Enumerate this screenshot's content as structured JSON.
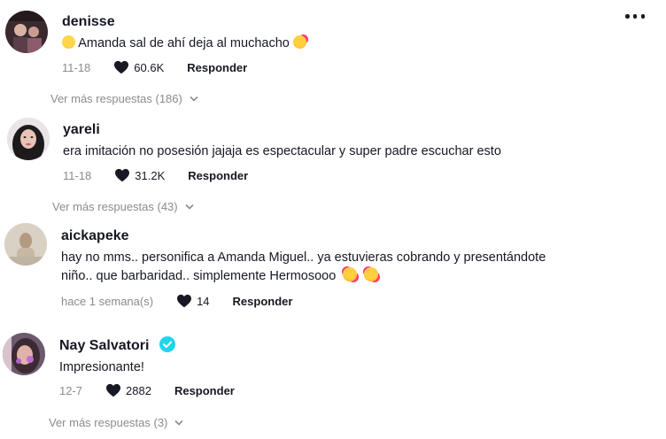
{
  "comments": [
    {
      "username": "denisse",
      "text_before": "",
      "text": "Amanda sal de ahí deja al muchacho",
      "leading_emoji": "flushed-face",
      "trailing_emoji": "smiling-hearts-face",
      "date": "11-18",
      "likes": "60.6K",
      "reply_label": "Responder",
      "more_replies": "Ver más respuestas (186)"
    },
    {
      "username": "yareli",
      "text": "era imitación no posesión jajaja es espectacular y super padre escuchar esto",
      "date": "11-18",
      "likes": "31.2K",
      "reply_label": "Responder",
      "more_replies": "Ver más respuestas (43)"
    },
    {
      "username": "aickapeke",
      "text_line1": "hay no mms.. personifica a Amanda Miguel.. ya estuvieras cobrando y presentándote",
      "text_line2": "niño.. que barbaridad.. simplemente Hermosooo",
      "trailing_emojis": [
        "smiling-hearts-face",
        "smiling-hearts-face"
      ],
      "date": "hace 1 semana(s)",
      "likes": "14",
      "reply_label": "Responder"
    },
    {
      "username": "Nay Salvatori",
      "verified": true,
      "text": "Impresionante!",
      "date": "12-7",
      "likes": "2882",
      "reply_label": "Responder",
      "more_replies": "Ver más respuestas (3)"
    }
  ],
  "colors": {
    "text": "#161823",
    "muted": "#8a8b91",
    "verified": "#20d5ec"
  },
  "icons": [
    "heart-icon",
    "chevron-down-icon",
    "more-options-icon",
    "verified-badge-icon"
  ]
}
